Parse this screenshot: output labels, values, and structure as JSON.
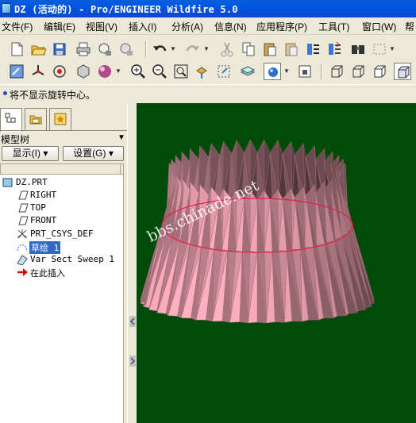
{
  "window": {
    "title": "DZ (活动的) - Pro/ENGINEER Wildfire 5.0"
  },
  "menu": [
    "文件(F)",
    "编辑(E)",
    "视图(V)",
    "插入(I)",
    "分析(A)",
    "信息(N)",
    "应用程序(P)",
    "工具(T)",
    "窗口(W)",
    "帮"
  ],
  "toolbar1": [
    "new-icon",
    "open-icon",
    "save-icon",
    "print-icon",
    "send-icon",
    "undo-icon",
    "redo-icon",
    "cut-icon",
    "copy-icon",
    "paste-icon",
    "paste-special-icon",
    "regenerate-icon",
    "regenerate-manager-icon",
    "find-icon",
    "select-box-icon"
  ],
  "toolbar2": [
    "repaint-icon",
    "spin-center-icon",
    "orient-mode-icon",
    "saved-views-icon",
    "appearance-icon",
    "zoom-in-icon",
    "zoom-out-icon",
    "refit-icon",
    "reorient-icon",
    "named-views-icon",
    "layers-icon",
    "display-style-icon",
    "view-manager-icon",
    "wireframe-icon",
    "hidden-line-icon",
    "no-hidden-icon",
    "shading-icon"
  ],
  "message": "将不显示旋转中心。",
  "left_panel": {
    "tabs": [
      "model-tree-tab",
      "folder-browser-tab",
      "favorites-tab"
    ],
    "header": "模型树",
    "show_button": "显示(I)",
    "settings_button": "设置(G)",
    "tree": [
      {
        "label": "DZ.PRT",
        "icon": "part-icon"
      },
      {
        "label": "RIGHT",
        "icon": "datum-plane-icon"
      },
      {
        "label": "TOP",
        "icon": "datum-plane-icon"
      },
      {
        "label": "FRONT",
        "icon": "datum-plane-icon"
      },
      {
        "label": "PRT_CSYS_DEF",
        "icon": "coordinate-system-icon"
      },
      {
        "label": "草绘 1",
        "icon": "sketch-icon"
      },
      {
        "label": "Var Sect Sweep 1",
        "icon": "sweep-icon"
      },
      {
        "label": "在此插入",
        "icon": "insert-here-arrow-icon"
      }
    ]
  },
  "viewport": {
    "watermark": "bbs.chinade.net",
    "background": "#004a0a",
    "model_color": "#e29aa8",
    "sketch_color": "#e0204a"
  }
}
